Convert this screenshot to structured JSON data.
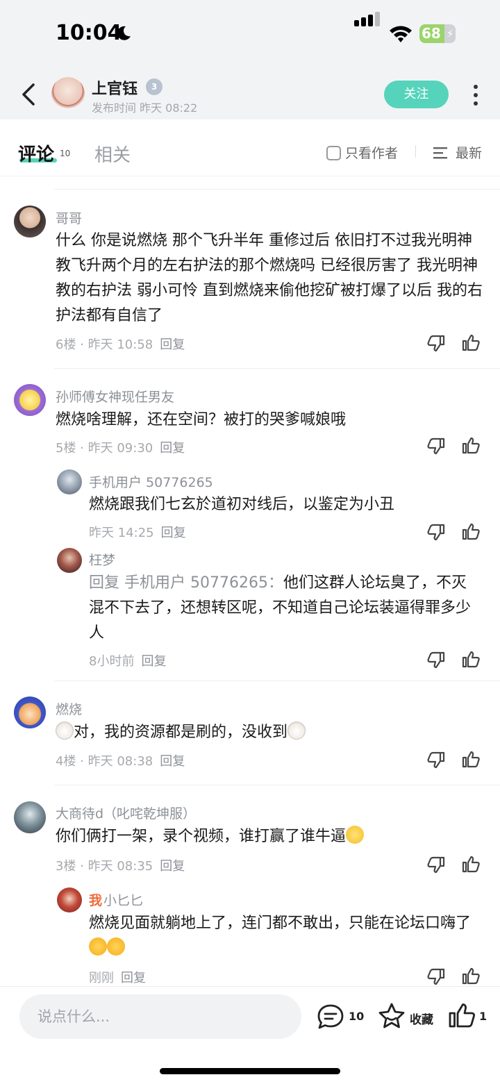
{
  "status_bar": {
    "time": "10:04",
    "battery": "68"
  },
  "header": {
    "author": "上官钰",
    "level_badge": "3",
    "publish_time": "发布时间 昨天 08:22",
    "follow_label": "关注"
  },
  "tabs": {
    "comments_label": "评论",
    "comments_count": "10",
    "related_label": "相关",
    "author_only_label": "只看作者",
    "sort_label": "最新",
    "active_color": "#56d3bb"
  },
  "comments": [
    {
      "user": "哥哥",
      "text": "什么 你是说燃烧 那个飞升半年 重修过后 依旧打不过我光明神教飞升两个月的左右护法的那个燃烧吗 已经很厉害了 我光明神教的右护法 弱小可怜 直到燃烧来偷他挖矿被打爆了以后 我的右护法都有自信了",
      "floor": "6楼",
      "time": "昨天 10:58",
      "reply_label": "回复"
    },
    {
      "user": "孙师傅女神现任男友",
      "text": "燃烧啥理解，还在空间？被打的哭爹喊娘哦",
      "floor": "5楼",
      "time": "昨天 09:30",
      "reply_label": "回复",
      "replies": [
        {
          "user": "手机用户 50776265",
          "text": "燃烧跟我们七玄於道初对线后，以鉴定为小丑",
          "time": "昨天 14:25",
          "reply_label": "回复"
        },
        {
          "user": "枉梦",
          "reply_prefix": "回复 手机用户 50776265：",
          "text": "他们这群人论坛臭了，不灭混不下去了，还想转区呢，不知道自己论坛装逼得罪多少人",
          "time": "8小时前",
          "reply_label": "回复"
        }
      ]
    },
    {
      "user": "燃烧",
      "text": "对，我的资源都是刷的，没收到",
      "floor": "4楼",
      "time": "昨天 08:38",
      "reply_label": "回复"
    },
    {
      "user": "大商待d（叱咤乾坤服）",
      "text": "你们俩打一架，录个视频，谁打赢了谁牛逼",
      "floor": "3楼",
      "time": "昨天 08:35",
      "reply_label": "回复",
      "replies": [
        {
          "me_tag": "我",
          "user": "小匕匕",
          "text": "燃烧见面就躺地上了，连门都不敢出，只能在论坛口嗨了",
          "time": "刚刚",
          "reply_label": "回复"
        }
      ]
    }
  ],
  "bottom_bar": {
    "input_placeholder": "说点什么...",
    "comment_count": "10",
    "favorite_label": "收藏",
    "like_count": "1"
  }
}
